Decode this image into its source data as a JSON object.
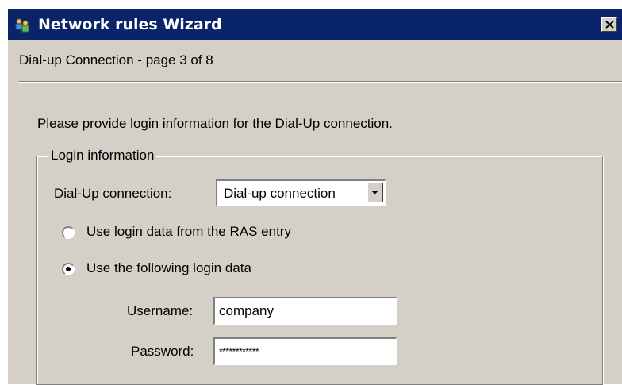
{
  "window": {
    "title": "Network rules Wizard",
    "close_symbol": "X",
    "app_icon": "network-users-icon"
  },
  "page": {
    "header": "Dial-up Connection - page 3 of 8",
    "intro": "Please provide login information for the Dial-Up connection."
  },
  "login_group": {
    "legend": "Login information",
    "dialup_label": "Dial-Up connection:",
    "dialup_selected": "Dial-up connection",
    "option_ras": "Use login data from the RAS entry",
    "option_ras_selected": false,
    "option_following": "Use the following login data",
    "option_following_selected": true,
    "username_label": "Username:",
    "username_value": "company",
    "password_label": "Password:",
    "password_value": "************"
  }
}
